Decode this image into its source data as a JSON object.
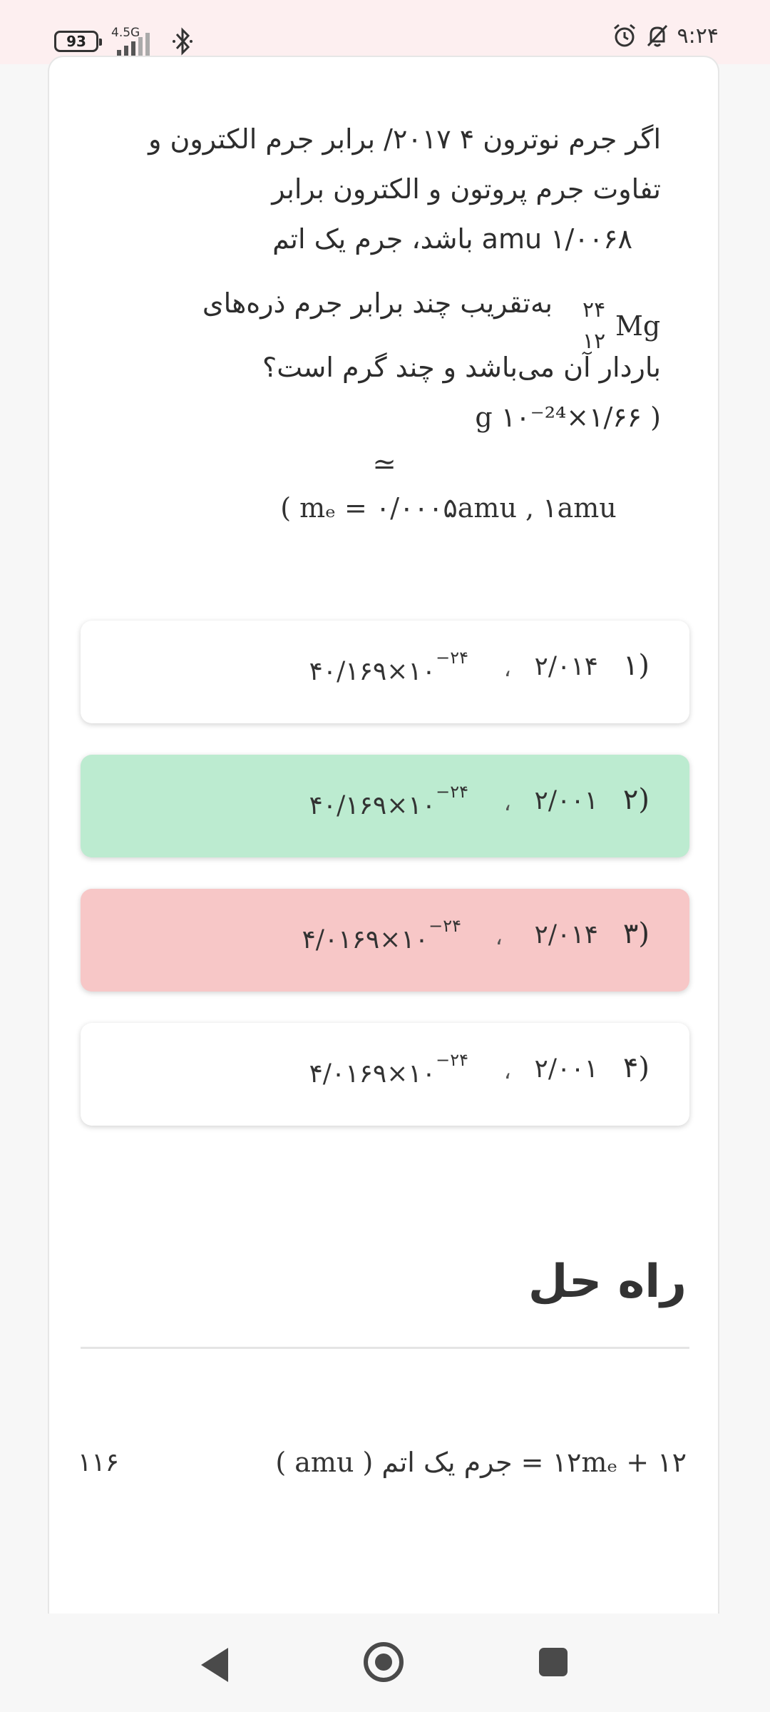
{
  "status": {
    "battery": "93",
    "network": "4.5G",
    "time": "۹:۲۴"
  },
  "question": {
    "line1": "اگر جرم نوترون ۴ ۲۰۱۷/ برابر جرم الکترون و",
    "line2": "تفاوت جرم پروتون و الکترون برابر",
    "line3": "۱/۰۰۶۸ amu باشد، جرم یک اتم",
    "isotope_mass": "۲۴",
    "isotope_number": "۱۲",
    "isotope_symbol": "Mg",
    "line4": "به‌تقریب چند برابر جرم ذره‌های",
    "line5": "باردار آن می‌باشد و چند گرم است؟",
    "line6": "( ۱/۶۶×۱۰⁻²⁴ g",
    "approx_symbol": "≃",
    "constants": "( mₑ = ۰/۰۰۰۵amu , ۱amu"
  },
  "options": [
    {
      "number": "۱)",
      "value1": "۲/۰۱۴",
      "value2": "۴۰/۱۶۹×۱۰",
      "exponent": "−۲۴",
      "state": "default"
    },
    {
      "number": "۲)",
      "value1": "۲/۰۰۱",
      "value2": "۴۰/۱۶۹×۱۰",
      "exponent": "−۲۴",
      "state": "correct"
    },
    {
      "number": "۳)",
      "value1": "۲/۰۱۴",
      "value2": "۴/۰۱۶۹×۱۰",
      "exponent": "−۲۴",
      "state": "wrong"
    },
    {
      "number": "۴)",
      "value1": "۲/۰۰۱",
      "value2": "۴/۰۱۶۹×۱۰",
      "exponent": "−۲۴",
      "state": "default"
    }
  ],
  "solution": {
    "title": "راه حل",
    "equation": "۱۲ + ۱۲mₑ = جرم یک اتم ( amu )",
    "equation_number": "۱۱۶"
  },
  "colors": {
    "correct_bg": "#bcebd0",
    "wrong_bg": "#f7c7c7",
    "status_bg": "#fdeff0"
  }
}
